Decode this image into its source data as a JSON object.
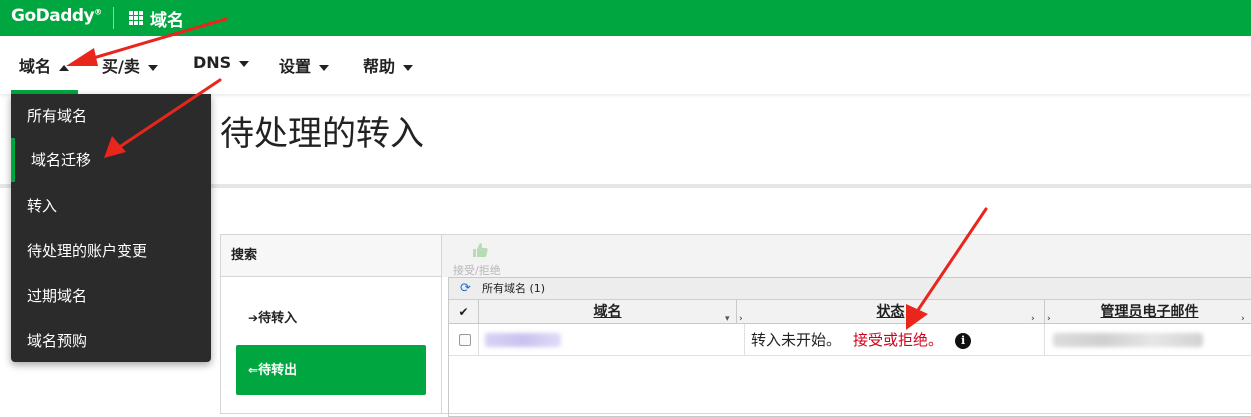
{
  "topbar": {
    "logo": "GoDaddy",
    "logo_mark": "®",
    "apps_icon": "grid-apps-icon",
    "title": "域名"
  },
  "nav": {
    "items": [
      {
        "label": "域名",
        "caret": "up"
      },
      {
        "label": "买/卖",
        "caret": "down"
      },
      {
        "label": "DNS",
        "caret": "down"
      },
      {
        "label": "设置",
        "caret": "down"
      },
      {
        "label": "帮助",
        "caret": "down"
      }
    ],
    "active_index": 0
  },
  "dropdown": {
    "items": [
      "所有域名",
      "域名迁移",
      "转入",
      "待处理的账户变更",
      "过期域名",
      "域名预购"
    ],
    "active_index": 1
  },
  "page": {
    "title": "待处理的转入"
  },
  "search_panel": {
    "header": "搜索",
    "filters": [
      {
        "arrow": "➔",
        "label": "待转入",
        "active": false
      },
      {
        "arrow": "⇐",
        "label": "待转出",
        "active": true
      }
    ]
  },
  "grid": {
    "toolbar_label": "接受/拒绝",
    "group_label": "所有域名 (1)",
    "columns": [
      "域名",
      "状态",
      "管理员电子邮件"
    ],
    "rows": [
      {
        "domain": "",
        "status_text": "转入未开始。",
        "status_link": "接受或拒绝。",
        "admin_email": ""
      }
    ]
  },
  "colors": {
    "brand": "#00a63f",
    "dropdown_bg": "#2b2b2b",
    "status_link": "#d0021b",
    "annotation_arrow": "#e8261c"
  }
}
